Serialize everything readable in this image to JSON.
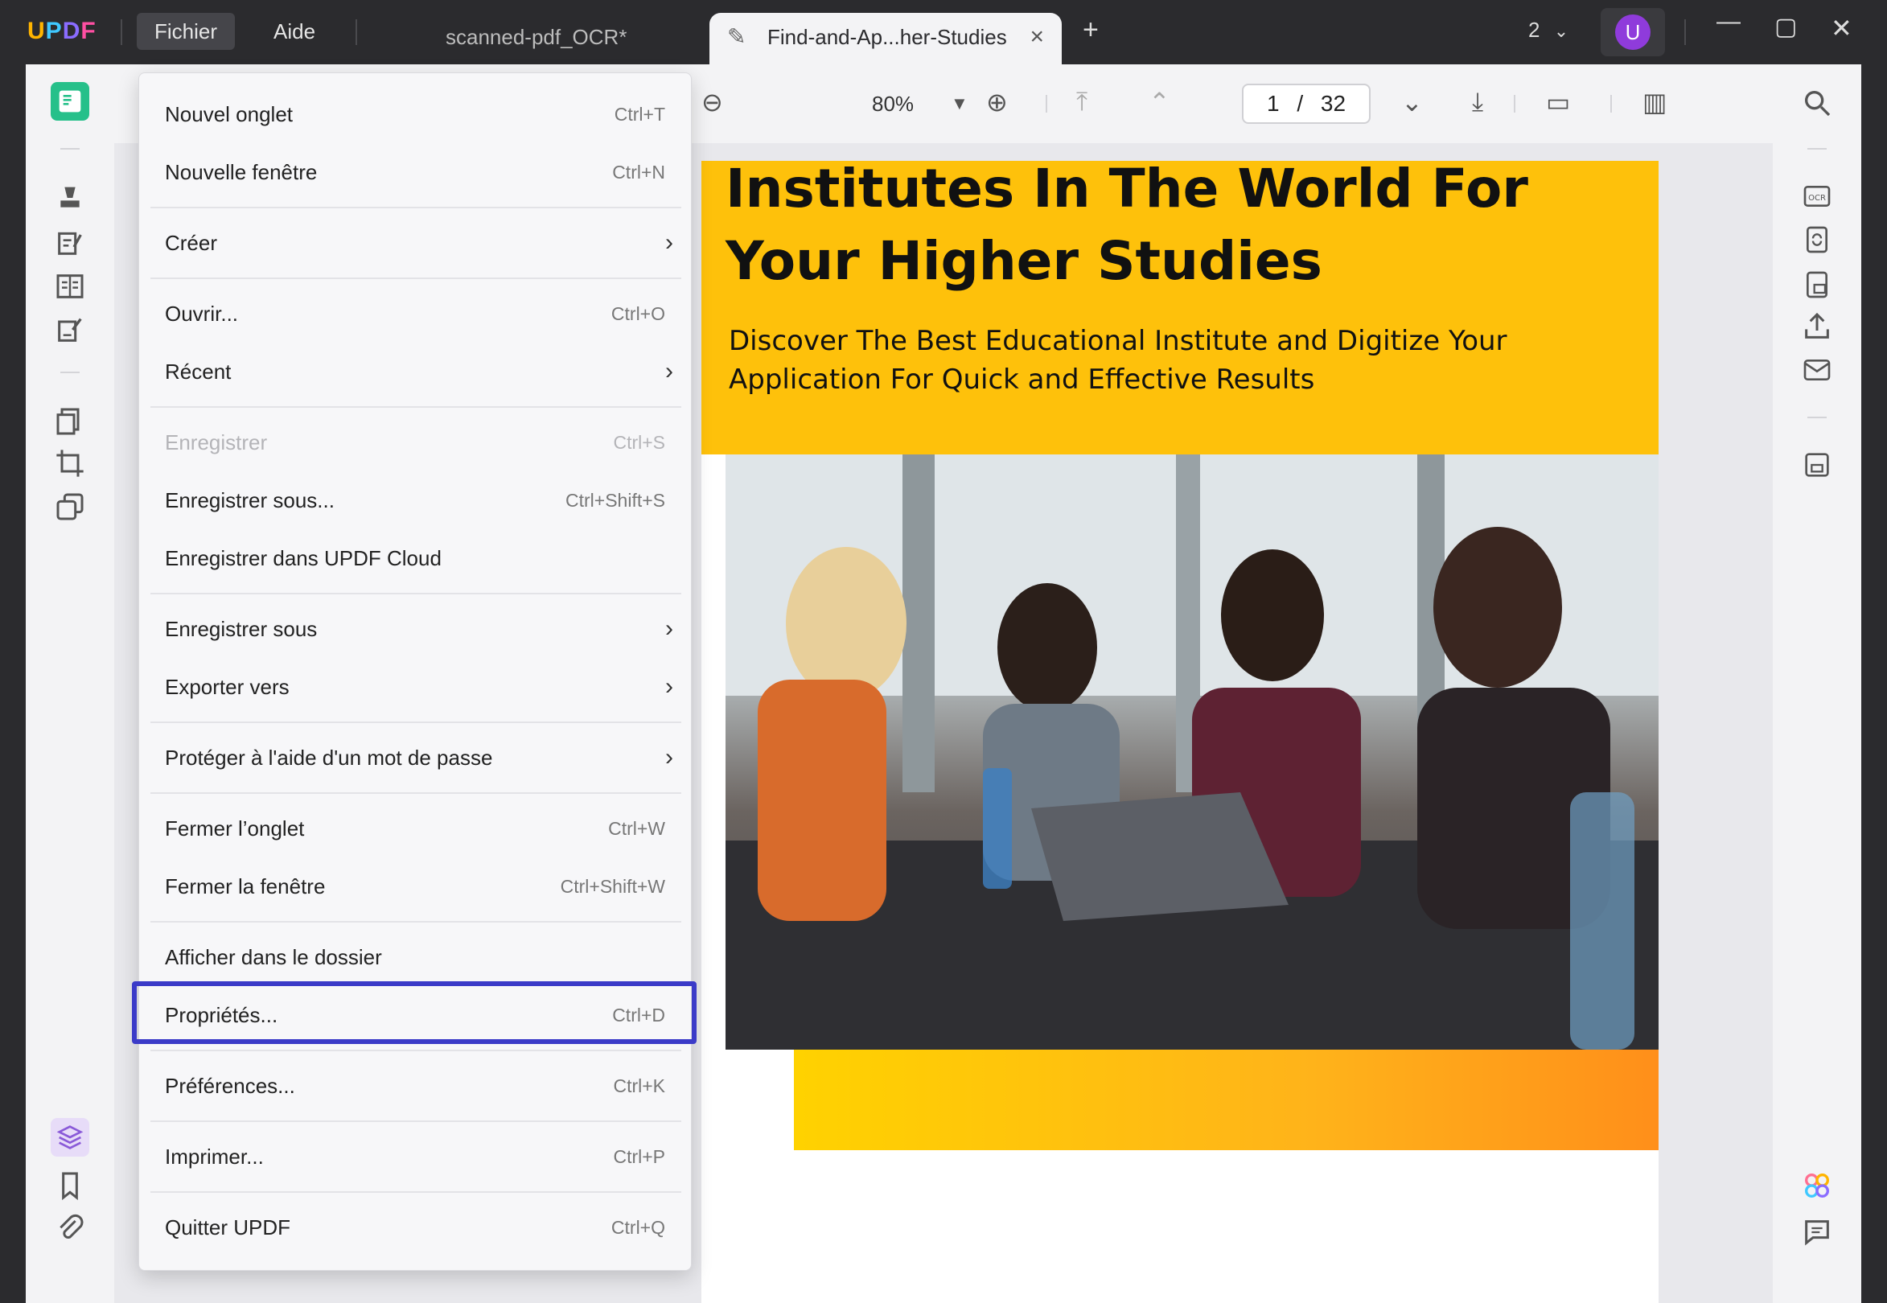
{
  "app": {
    "logo": "UPDF",
    "menus": [
      {
        "label": "Fichier"
      },
      {
        "label": "Aide"
      }
    ],
    "tabs": [
      {
        "label": "scanned-pdf_OCR*"
      },
      {
        "label": "Find-and-Ap...her-Studies"
      }
    ],
    "window_count": "2",
    "user_initial": "U"
  },
  "toolbar": {
    "zoom": "80%",
    "current_page": "1",
    "page_separator": "/",
    "total_pages": "32"
  },
  "document": {
    "title": "Institutes In The World For Your Higher Studies",
    "subtitle": "Discover The Best Educational Institute and Digitize Your Application For Quick and Effective Results"
  },
  "file_menu": {
    "items": [
      {
        "label": "Nouvel onglet",
        "shortcut": "Ctrl+T"
      },
      {
        "label": "Nouvelle fenêtre",
        "shortcut": "Ctrl+N"
      },
      {
        "label": "Créer",
        "submenu": true
      },
      {
        "label": "Ouvrir...",
        "shortcut": "Ctrl+O"
      },
      {
        "label": "Récent",
        "submenu": true
      },
      {
        "label": "Enregistrer",
        "shortcut": "Ctrl+S",
        "disabled": true
      },
      {
        "label": "Enregistrer sous...",
        "shortcut": "Ctrl+Shift+S"
      },
      {
        "label": "Enregistrer dans UPDF Cloud"
      },
      {
        "label": "Enregistrer sous",
        "submenu": true
      },
      {
        "label": "Exporter vers",
        "submenu": true
      },
      {
        "label": "Protéger à l'aide d'un mot de passe",
        "submenu": true
      },
      {
        "label": "Fermer l’onglet",
        "shortcut": "Ctrl+W"
      },
      {
        "label": "Fermer la fenêtre",
        "shortcut": "Ctrl+Shift+W"
      },
      {
        "label": "Afficher dans le dossier"
      },
      {
        "label": "Propriétés...",
        "shortcut": "Ctrl+D",
        "highlighted": true
      },
      {
        "label": "Préférences...",
        "shortcut": "Ctrl+K"
      },
      {
        "label": "Imprimer...",
        "shortcut": "Ctrl+P"
      },
      {
        "label": "Quitter UPDF",
        "shortcut": "Ctrl+Q"
      }
    ]
  },
  "colors": {
    "highlight_border": "#3b3bc8",
    "hero_yellow": "#fec10b",
    "avatar": "#8f3bdb"
  }
}
